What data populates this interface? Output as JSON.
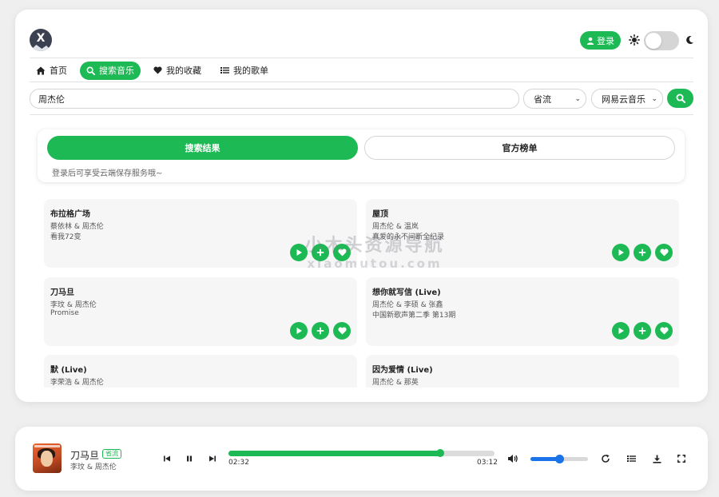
{
  "header": {
    "login_label": "登录"
  },
  "nav": {
    "items": [
      {
        "label": "首页",
        "icon": "home-icon"
      },
      {
        "label": "搜索音乐",
        "icon": "search-icon",
        "active": true
      },
      {
        "label": "我的收藏",
        "icon": "heart-icon"
      },
      {
        "label": "我的歌单",
        "icon": "list-icon"
      }
    ]
  },
  "search": {
    "query": "周杰伦",
    "quality_value": "省流",
    "source_value": "网易云音乐"
  },
  "tabs": {
    "results_label": "搜索结果",
    "charts_label": "官方榜单",
    "login_note": "登录后可享受云端保存服务哦~"
  },
  "songs": [
    {
      "title": "布拉格广场",
      "artist": "蔡依林 & 周杰伦",
      "album": "看我72变"
    },
    {
      "title": "屋顶",
      "artist": "周杰伦 & 温岚",
      "album": "真爱的永不间断全纪录"
    },
    {
      "title": "刀马旦",
      "artist": "李玟 & 周杰伦",
      "album": "Promise"
    },
    {
      "title": "想你就写信 (Live)",
      "artist": "周杰伦 & 李硕 & 张鑫",
      "album": "中国新歌声第二季 第13期"
    },
    {
      "title": "默 (Live)",
      "artist": "李荣浩 & 周杰伦",
      "album": ""
    },
    {
      "title": "因为爱情 (Live)",
      "artist": "周杰伦 & 那英",
      "album": ""
    }
  ],
  "watermark": {
    "line1": "小木头资源导航",
    "line2": "xiaomutou.com"
  },
  "player": {
    "title": "刀马旦",
    "quality_badge": "省流",
    "artist": "李玟 & 周杰伦",
    "current_time": "02:32",
    "total_time": "03:12",
    "progress_fraction": 0.795,
    "volume_fraction": 0.5
  },
  "colors": {
    "accent": "#1db954",
    "volume": "#1a73e8"
  }
}
